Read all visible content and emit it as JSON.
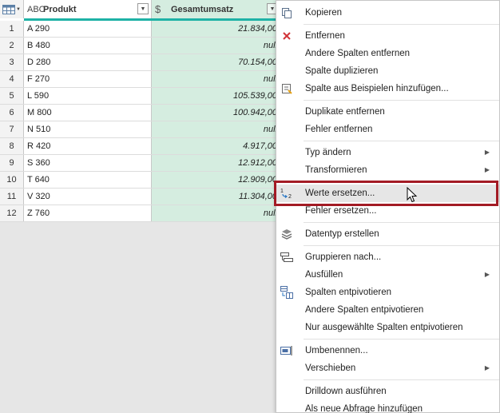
{
  "table": {
    "columns": [
      {
        "type": "ABC",
        "name": "Produkt"
      },
      {
        "type": "$",
        "name": "Gesamtumsatz"
      }
    ],
    "rows": [
      {
        "n": "1",
        "produkt": "A 290",
        "umsatz": "21.834,00"
      },
      {
        "n": "2",
        "produkt": "B 480",
        "umsatz": "null"
      },
      {
        "n": "3",
        "produkt": "D 280",
        "umsatz": "70.154,00"
      },
      {
        "n": "4",
        "produkt": "F 270",
        "umsatz": "null"
      },
      {
        "n": "5",
        "produkt": "L 590",
        "umsatz": "105.539,00"
      },
      {
        "n": "6",
        "produkt": "M 800",
        "umsatz": "100.942,00"
      },
      {
        "n": "7",
        "produkt": "N 510",
        "umsatz": "null"
      },
      {
        "n": "8",
        "produkt": "R 420",
        "umsatz": "4.917,00"
      },
      {
        "n": "9",
        "produkt": "S 360",
        "umsatz": "12.912,00"
      },
      {
        "n": "10",
        "produkt": "T 640",
        "umsatz": "12.909,00"
      },
      {
        "n": "11",
        "produkt": "V 320",
        "umsatz": "11.304,00"
      },
      {
        "n": "12",
        "produkt": "Z 760",
        "umsatz": "null"
      }
    ]
  },
  "menu": {
    "copy": "Kopieren",
    "remove": "Entfernen",
    "remove_other": "Andere Spalten entfernen",
    "duplicate_col": "Spalte duplizieren",
    "col_from_examples": "Spalte aus Beispielen hinzufügen...",
    "remove_duplicates": "Duplikate entfernen",
    "remove_errors": "Fehler entfernen",
    "change_type": "Typ ändern",
    "transform": "Transformieren",
    "replace_values": "Werte ersetzen...",
    "replace_errors": "Fehler ersetzen...",
    "create_datatype": "Datentyp erstellen",
    "group_by": "Gruppieren nach...",
    "fill": "Ausfüllen",
    "unpivot": "Spalten entpivotieren",
    "unpivot_other": "Andere Spalten entpivotieren",
    "unpivot_selected": "Nur ausgewählte Spalten entpivotieren",
    "rename": "Umbenennen...",
    "move": "Verschieben",
    "drilldown": "Drilldown ausführen",
    "add_as_query": "Als neue Abfrage hinzufügen"
  },
  "colors": {
    "selected_column": "#d5ede0",
    "quality_bar": "#1eb2a6",
    "annotation_box": "#a31b25"
  }
}
